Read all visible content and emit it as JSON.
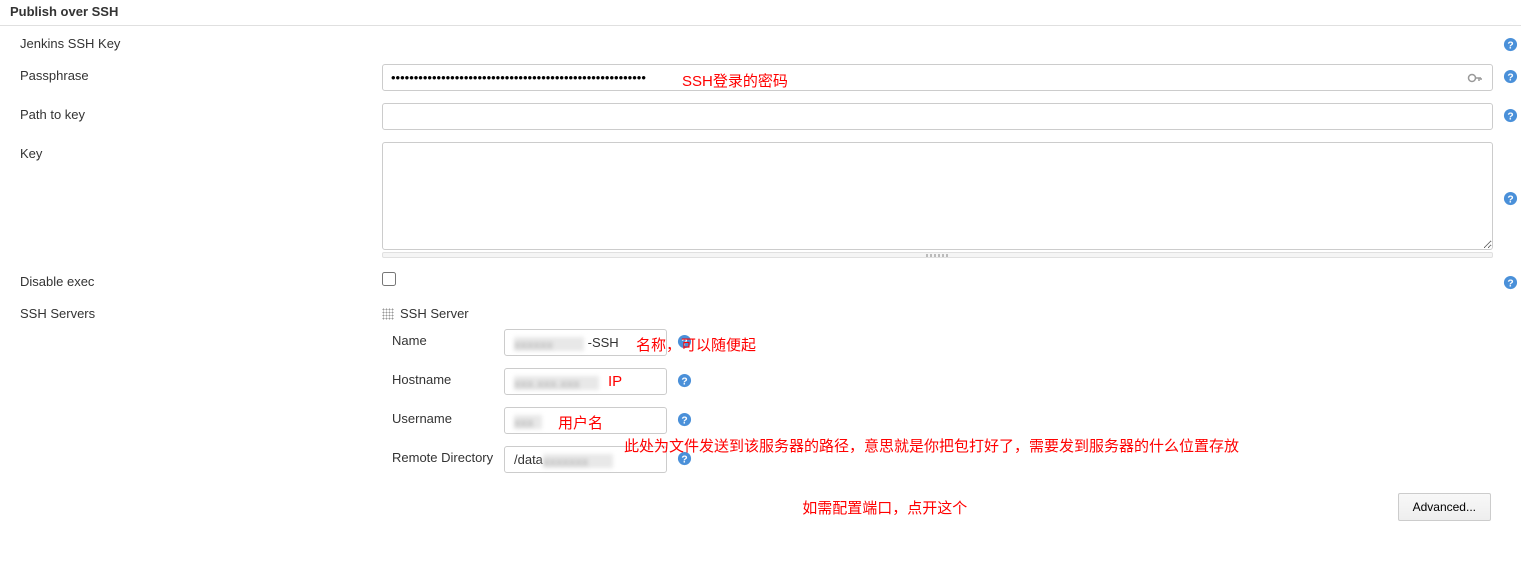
{
  "section": {
    "title": "Publish over SSH"
  },
  "fields": {
    "jenkins_key_label": "Jenkins SSH Key",
    "passphrase_label": "Passphrase",
    "passphrase_value": "••••••••••••••••••••••••••••••••••••••••••••••••••••••••",
    "path_to_key_label": "Path to key",
    "path_to_key_value": "",
    "key_label": "Key",
    "key_value": "",
    "disable_exec_label": "Disable exec",
    "disable_exec_checked": false,
    "ssh_servers_label": "SSH Servers"
  },
  "server": {
    "header": "SSH Server",
    "name_label": "Name",
    "name_suffix": "-SSH",
    "hostname_label": "Hostname",
    "hostname_value": "",
    "username_label": "Username",
    "username_value": "",
    "remote_dir_label": "Remote Directory",
    "remote_dir_prefix": "/data"
  },
  "buttons": {
    "advanced": "Advanced..."
  },
  "annotations": {
    "passphrase": "SSH登录的密码",
    "name": "名称，可以随便起",
    "hostname": "IP",
    "username": "用户名",
    "remote_dir": "此处为文件发送到该服务器的路径，意思就是你把包打好了，需要发到服务器的什么位置存放",
    "advanced": "如需配置端口，点开这个"
  }
}
